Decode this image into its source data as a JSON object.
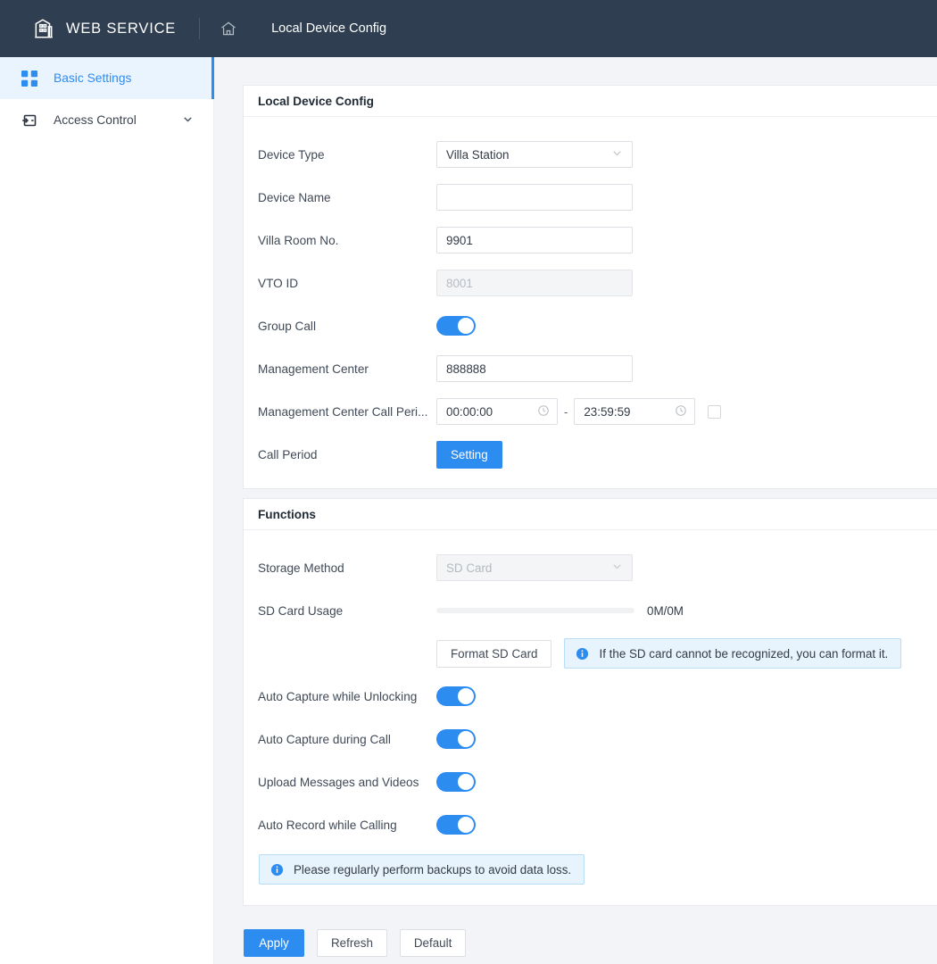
{
  "header": {
    "brand": "WEB SERVICE",
    "logo_icon": "building-icon",
    "home_icon": "home-icon",
    "breadcrumb": "Local Device Config"
  },
  "sidebar": {
    "items": [
      {
        "label": "Basic Settings",
        "icon": "grid-icon",
        "active": true
      },
      {
        "label": "Access Control",
        "icon": "access-card-icon",
        "active": false,
        "chevron": "chevron-down-icon"
      }
    ]
  },
  "panels": {
    "device": {
      "title": "Local Device Config",
      "fields": {
        "device_type": {
          "label": "Device Type",
          "value": "Villa Station"
        },
        "device_name": {
          "label": "Device Name",
          "value": "",
          "placeholder": ""
        },
        "villa_room_no": {
          "label": "Villa Room No.",
          "value": "9901"
        },
        "vto_id": {
          "label": "VTO ID",
          "value": "",
          "placeholder": "8001",
          "disabled": true
        },
        "group_call": {
          "label": "Group Call",
          "state": "on"
        },
        "management_center": {
          "label": "Management Center",
          "value": "888888"
        },
        "mgmt_call_period": {
          "label": "Management Center Call Peri...",
          "start": "00:00:00",
          "end": "23:59:59",
          "separator": "-",
          "clock_icon": "clock-icon",
          "checkbox_checked": false
        },
        "call_period": {
          "label": "Call Period",
          "button": "Setting"
        }
      }
    },
    "functions": {
      "title": "Functions",
      "fields": {
        "storage_method": {
          "label": "Storage Method",
          "value": "SD Card",
          "disabled": true
        },
        "sd_card_usage": {
          "label": "SD Card Usage",
          "usage_text": "0M/0M",
          "percent": 0
        },
        "format_sd": {
          "button": "Format SD Card",
          "hint": "If the SD card cannot be recognized, you can format it."
        },
        "auto_capture_unlocking": {
          "label": "Auto Capture while Unlocking",
          "state": "on"
        },
        "auto_capture_call": {
          "label": "Auto Capture during Call",
          "state": "on"
        },
        "upload_messages": {
          "label": "Upload Messages and Videos",
          "state": "on"
        },
        "auto_record": {
          "label": "Auto Record while Calling",
          "state": "on"
        },
        "backup_hint": "Please regularly perform backups to avoid data loss."
      }
    }
  },
  "footer": {
    "apply": "Apply",
    "refresh": "Refresh",
    "default": "Default"
  },
  "colors": {
    "header_bg": "#2f3e50",
    "accent": "#2d8cf0",
    "active_nav_bg": "#eaf4fe",
    "content_bg": "#f2f4f7",
    "banner_bg": "#e8f4fd",
    "banner_border": "#b9dcf7"
  }
}
